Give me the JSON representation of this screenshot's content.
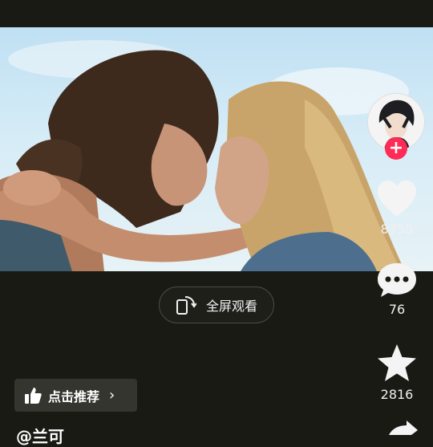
{
  "player": {
    "fullscreen_label": "全屏观看"
  },
  "sidebar": {
    "likes": "8755",
    "comments": "76",
    "favorites": "2816"
  },
  "recommend": {
    "label": "点击推荐",
    "chevron": "›"
  },
  "caption": {
    "text": "@兰可"
  },
  "icons": {
    "like": "heart-icon",
    "comment": "comment-icon",
    "favorite": "star-icon",
    "share": "share-icon",
    "fullscreen": "rotate-screen-icon",
    "recommend": "thumbs-up-icon"
  },
  "colors": {
    "background": "#181a13",
    "follow_plus": "#ff2a55"
  }
}
